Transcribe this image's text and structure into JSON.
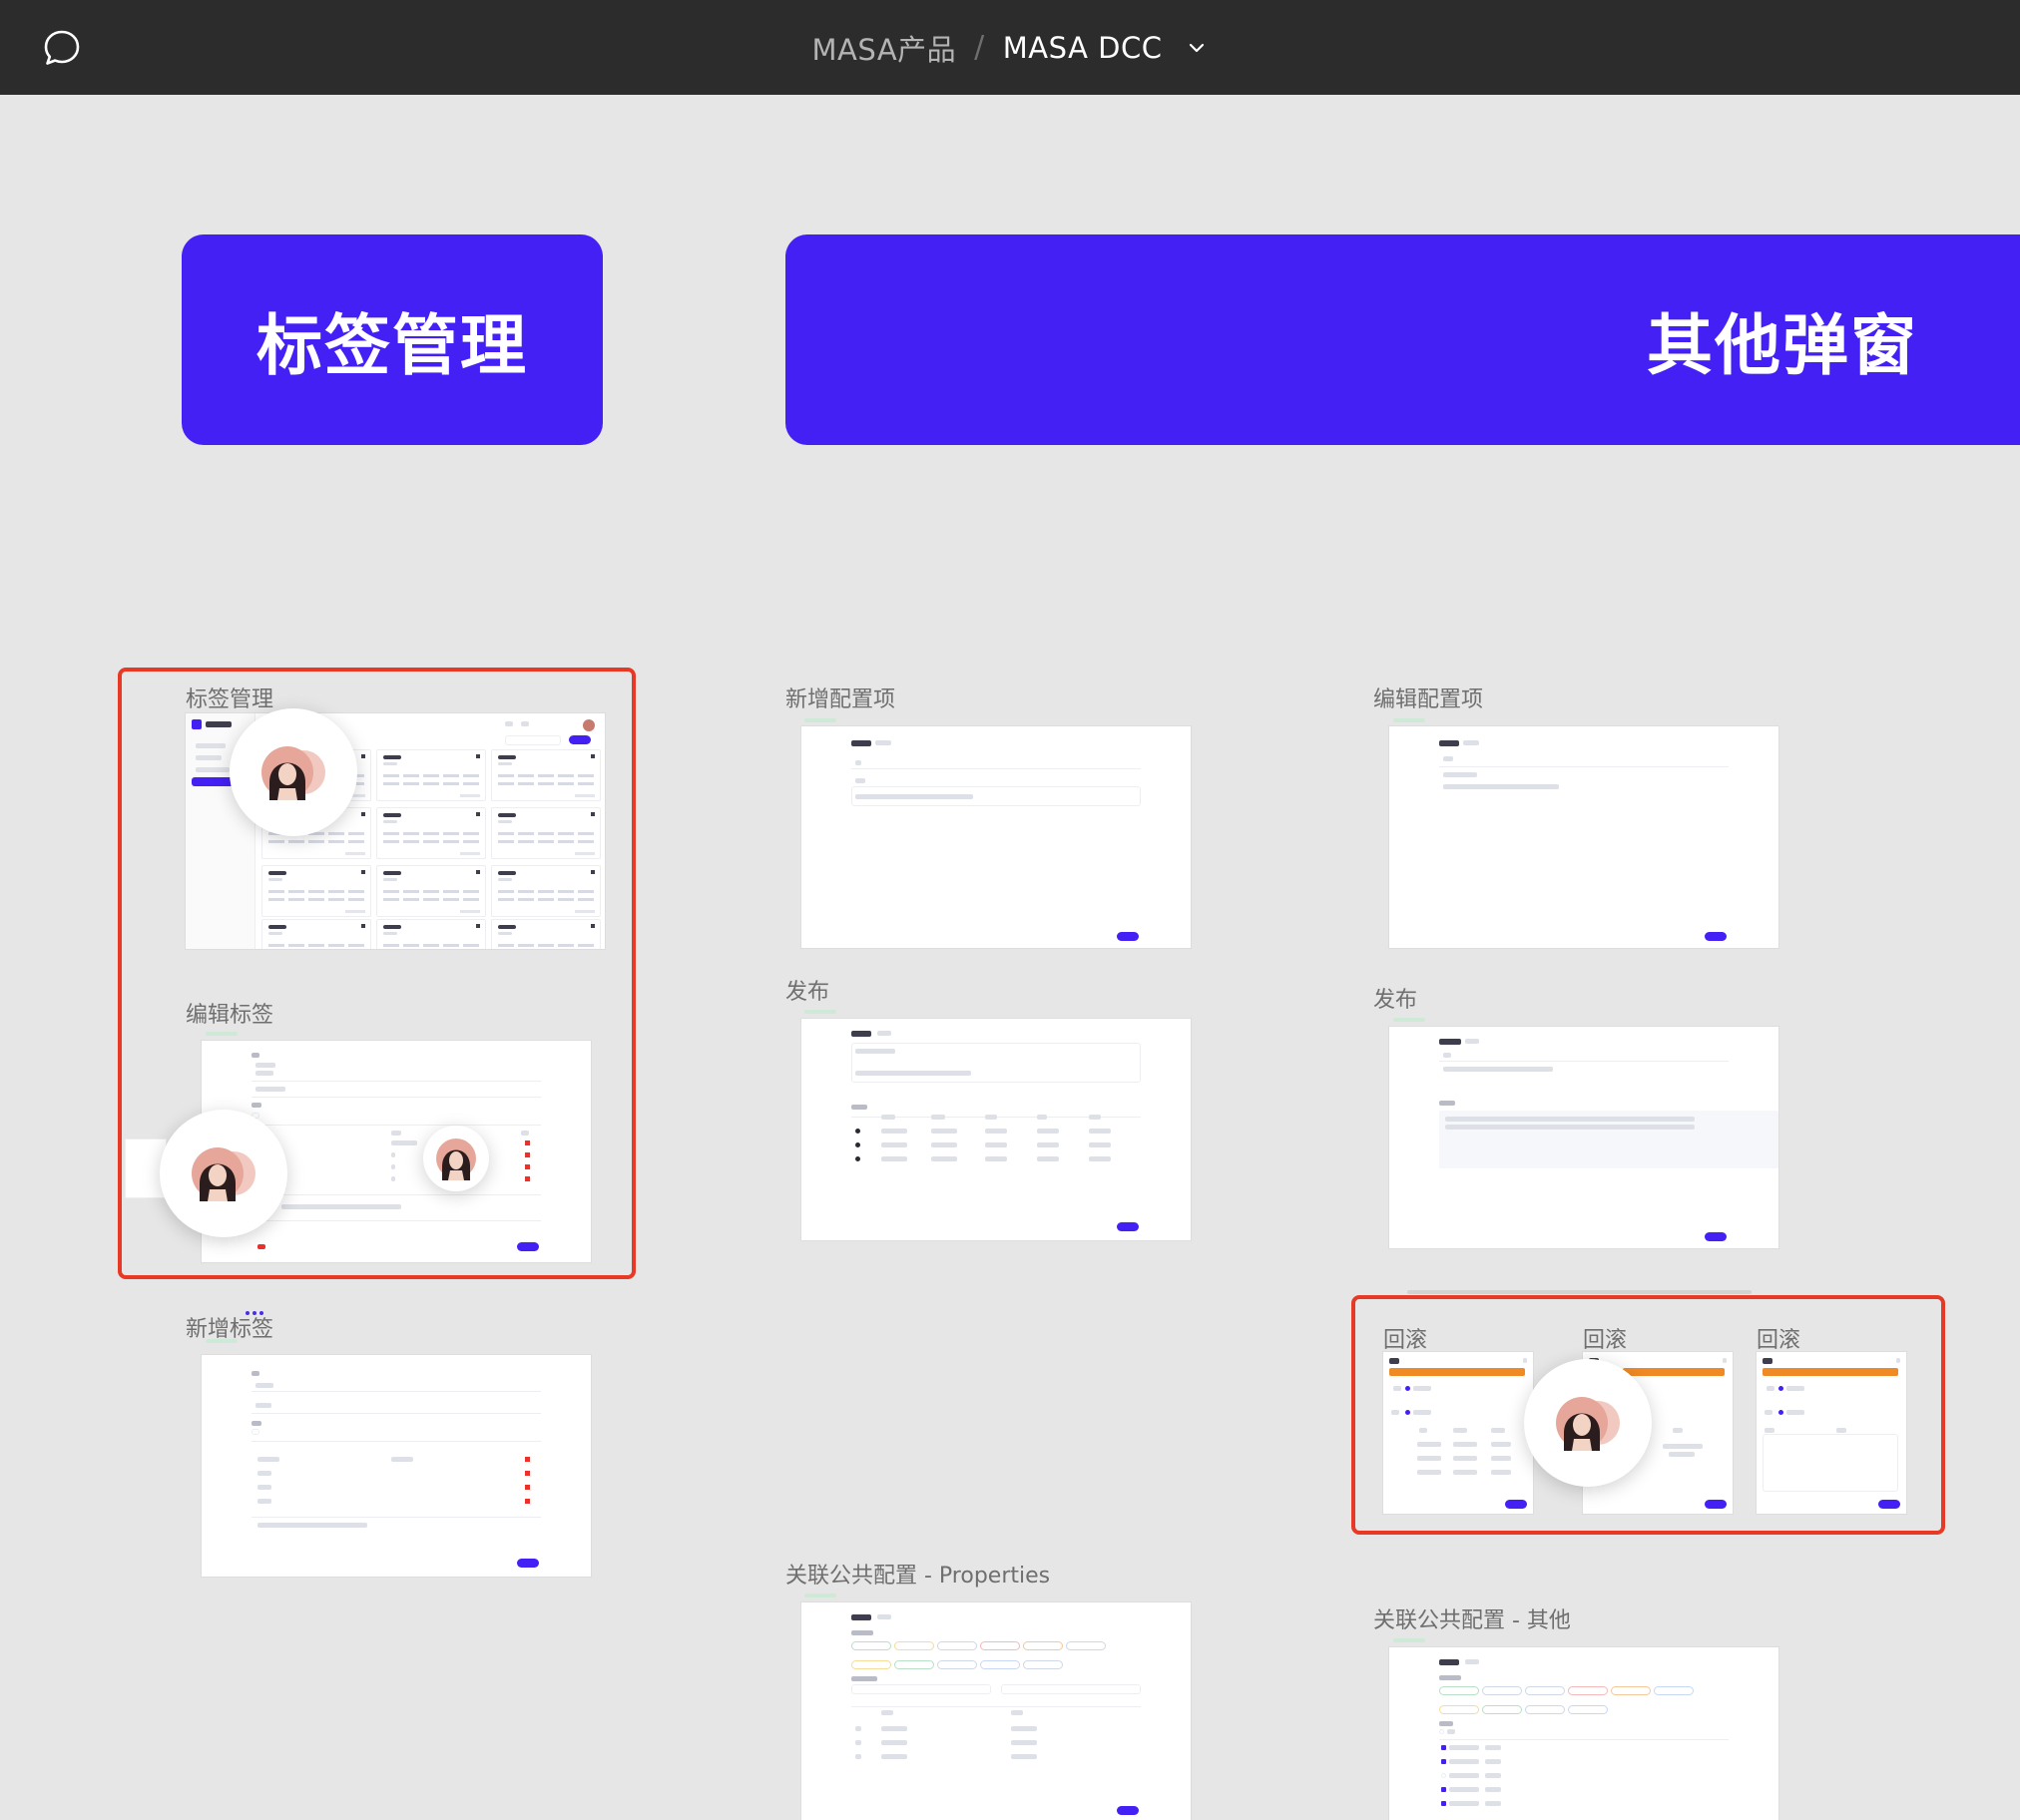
{
  "topbar": {
    "breadcrumb_parent": "MASA产品",
    "breadcrumb_separator": "/",
    "breadcrumb_current": "MASA DCC"
  },
  "banners": {
    "tags": "标签管理",
    "other": "其他弹窗"
  },
  "frames": {
    "tag_manage": "标签管理",
    "edit_tag": "编辑标签",
    "add_tag": "新增标签",
    "add_config": "新增配置项",
    "edit_config": "编辑配置项",
    "publish_1": "发布",
    "publish_2": "发布",
    "rollback_1": "回滚",
    "rollback_2": "回滚",
    "rollback_3": "回滚",
    "link_public_props": "关联公共配置 - Properties",
    "link_public_other": "关联公共配置 - 其他"
  },
  "colors": {
    "accent": "#4520f5",
    "selection": "#e63a26",
    "canvas": "#e6e6e6",
    "topbar": "#2c2c2c"
  },
  "icons": {
    "comment": "comment-icon",
    "dropdown": "chevron-down-icon"
  }
}
